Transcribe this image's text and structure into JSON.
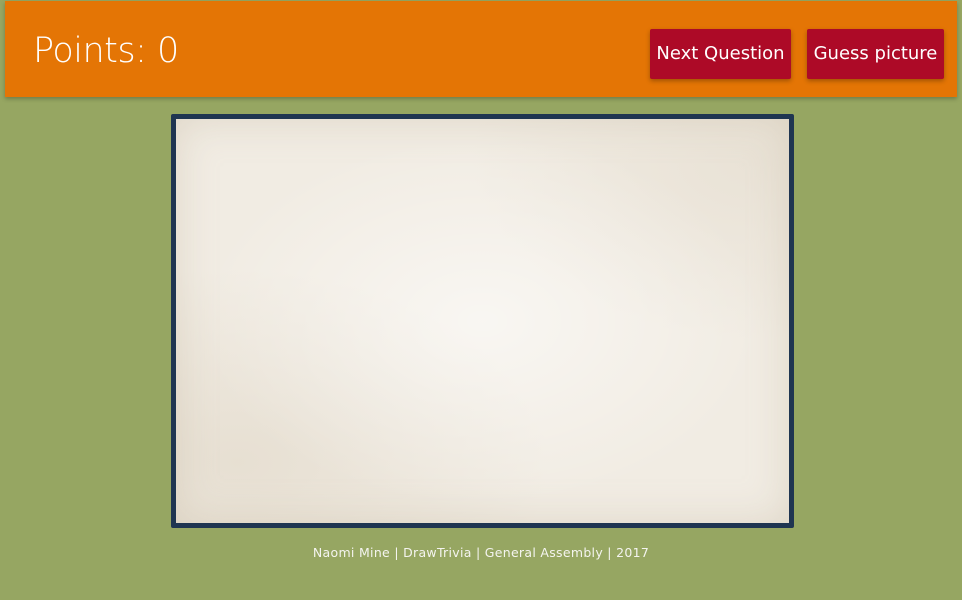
{
  "header": {
    "points_text": "Points: 0",
    "next_question_label": "Next Question",
    "guess_picture_label": "Guess picture"
  },
  "footer": {
    "credit_text": "Naomi Mine | DrawTrivia | General Assembly | 2017"
  },
  "colors": {
    "background": "#96a662",
    "header": "#e47505",
    "button": "#ad0a27",
    "board_border": "#1f3551",
    "board_fill": "#f1ece3"
  }
}
